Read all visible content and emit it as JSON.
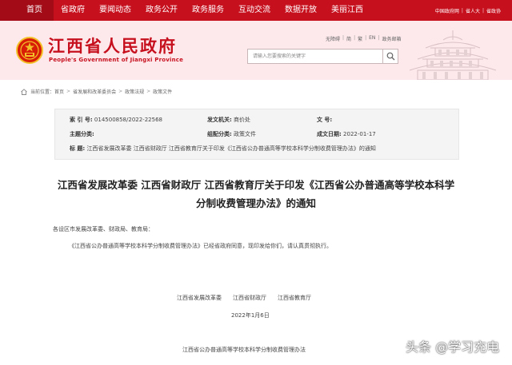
{
  "nav": {
    "items": [
      "首页",
      "省政府",
      "要闻动态",
      "政务公开",
      "政务服务",
      "互动交流",
      "数据开放",
      "美丽江西"
    ],
    "right_links": [
      "中国政府网",
      "省人大",
      "省政协"
    ]
  },
  "header": {
    "title": "江西省人民政府",
    "subtitle": "People's Government of Jiangxi Province",
    "links": [
      "无障碍",
      "简",
      "繁",
      "EN",
      "政务邮箱"
    ],
    "search_placeholder": "请输入您要搜索的关键字"
  },
  "breadcrumb": {
    "prefix": "当前位置：",
    "items": [
      "首页",
      "省发展和改革委员会",
      "政策法规",
      "政策文件"
    ]
  },
  "meta": {
    "index_label": "索  引  号:",
    "index_value": "014500858/2022-22568",
    "issuer_label": "发文机关:",
    "issuer_value": "商价处",
    "docno_label": "文      号:",
    "docno_value": "",
    "topic_label": "主题分类:",
    "topic_value": "",
    "genre_label": "组配分类:",
    "genre_value": "政策文件",
    "date_label": "成文日期:",
    "date_value": "2022-01-17",
    "title_label": "标      题:",
    "title_value": "江西省发展改革委 江西省财政厅 江西省教育厅关于印发《江西省公办普通高等学校本科学分制收费管理办法》的通知"
  },
  "article": {
    "title_line1": "江西省发展改革委 江西省财政厅 江西省教育厅关于印发《江西省公办普通高等学校本科学",
    "title_line2": "分制收费管理办法》的通知",
    "addressee": "各设区市发展改革委、财政局、教育局：",
    "body": "《江西省公办普通高等学校本科学分制收费管理办法》已经省政府同意，现印发给你们，请认真贯彻执行。",
    "issuers": [
      "江西省发展改革委",
      "江西省财政厅",
      "江西省教育厅"
    ],
    "date": "2022年1月6日",
    "attachment_title": "江西省公办普通高等学校本科学分制收费管理办法"
  },
  "watermark": "头条 @学习充电",
  "colors": {
    "brand_red": "#c7101e",
    "header_bg": "#fde9ec",
    "meta_bg": "#f4f4f4"
  },
  "icons": {
    "search": "search-icon",
    "home": "home-icon",
    "emblem": "national-emblem-icon"
  }
}
